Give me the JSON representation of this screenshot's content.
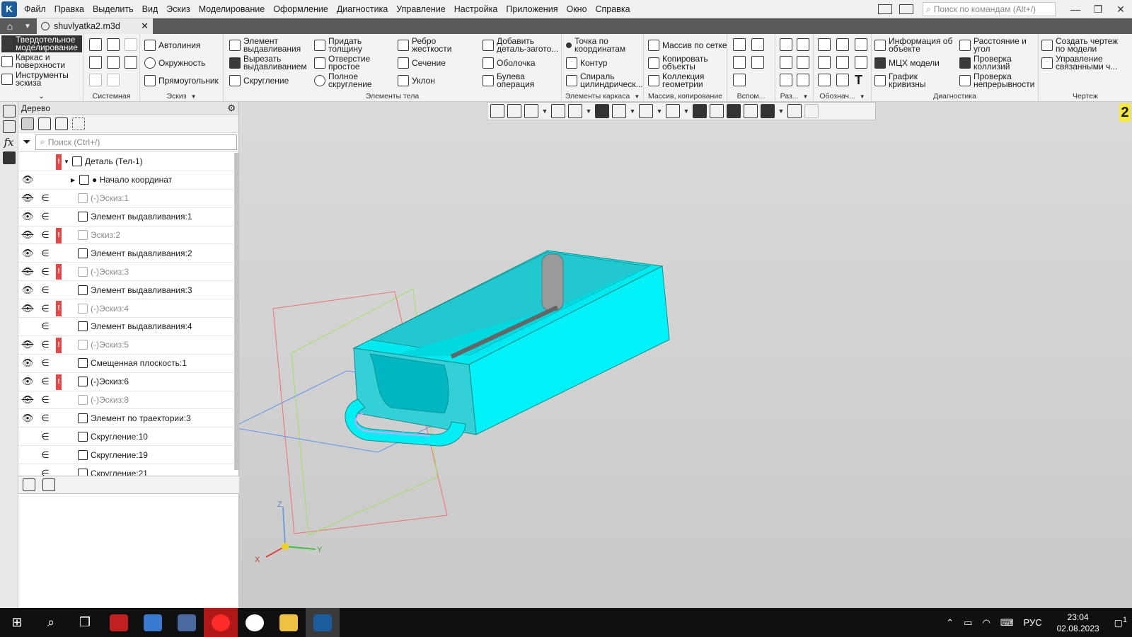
{
  "menubar": {
    "items": [
      "Файл",
      "Правка",
      "Выделить",
      "Вид",
      "Эскиз",
      "Моделирование",
      "Оформление",
      "Диагностика",
      "Управление",
      "Настройка",
      "Приложения",
      "Окно",
      "Справка"
    ],
    "search_placeholder": "Поиск по командам (Alt+/)"
  },
  "tab": {
    "title": "shuvlyatka2.m3d"
  },
  "ribbon": {
    "modes": [
      "Твердотельное моделирование",
      "Каркас и поверхности",
      "Инструменты эскиза"
    ],
    "groups": {
      "system": "Системная",
      "sketch": "Эскиз",
      "body": "Элементы тела",
      "frame": "Элементы каркаса",
      "array": "Массив, копирование",
      "aux": "Вспом...",
      "raz": "Раз...",
      "oboz": "Обознач...",
      "diag": "Диагностика",
      "drawing": "Чертеж"
    },
    "sketch_btns": [
      "Автолиния",
      "Окружность",
      "Прямоугольник"
    ],
    "body_btns": [
      "Элемент выдавливания",
      "Вырезать выдавливанием",
      "Скругление",
      "Придать толщину",
      "Отверстие простое",
      "Полное скругление",
      "Ребро жесткости",
      "Сечение",
      "Уклон",
      "Добавить деталь-загото...",
      "Оболочка",
      "Булева операция"
    ],
    "frame_btns": [
      "Точка по координатам",
      "Контур",
      "Спираль цилиндрическ..."
    ],
    "array_btns": [
      "Массив по сетке",
      "Копировать объекты",
      "Коллекция геометрии"
    ],
    "diag_btns": [
      "Информация об объекте",
      "МЦХ модели",
      "График кривизны",
      "Расстояние и угол",
      "Проверка коллизий",
      "Проверка непрерывности"
    ],
    "drawing_btns": [
      "Создать чертеж по модели",
      "Управление связанными ч..."
    ]
  },
  "tree": {
    "title": "Дерево",
    "search_placeholder": "Поиск (Ctrl+/)",
    "rows": [
      {
        "label": "Деталь (Тел-1)",
        "eye": "",
        "in": "",
        "err": true,
        "dim": false
      },
      {
        "label": "● Начало координат",
        "eye": "visible",
        "in": "",
        "err": false,
        "dim": false
      },
      {
        "label": "(-)Эскиз:1",
        "eye": "hidden",
        "in": "∈",
        "err": false,
        "dim": true
      },
      {
        "label": "Элемент выдавливания:1",
        "eye": "visible",
        "in": "∈",
        "err": false,
        "dim": false
      },
      {
        "label": "Эскиз:2",
        "eye": "hidden",
        "in": "∈",
        "err": true,
        "dim": true
      },
      {
        "label": "Элемент выдавливания:2",
        "eye": "visible",
        "in": "∈",
        "err": false,
        "dim": false
      },
      {
        "label": "(-)Эскиз:3",
        "eye": "hidden",
        "in": "∈",
        "err": true,
        "dim": true
      },
      {
        "label": "Элемент выдавливания:3",
        "eye": "visible",
        "in": "∈",
        "err": false,
        "dim": false
      },
      {
        "label": "(-)Эскиз:4",
        "eye": "hidden",
        "in": "∈",
        "err": true,
        "dim": true
      },
      {
        "label": "Элемент выдавливания:4",
        "eye": "",
        "in": "∈",
        "err": false,
        "dim": false
      },
      {
        "label": "(-)Эскиз:5",
        "eye": "hidden",
        "in": "∈",
        "err": true,
        "dim": true
      },
      {
        "label": "Смещенная плоскость:1",
        "eye": "visible",
        "in": "∈",
        "err": false,
        "dim": false
      },
      {
        "label": "(-)Эскиз:6",
        "eye": "visible",
        "in": "∈",
        "err": true,
        "dim": false
      },
      {
        "label": "(-)Эскиз:8",
        "eye": "hidden",
        "in": "∈",
        "err": false,
        "dim": true
      },
      {
        "label": "Элемент по траектории:3",
        "eye": "visible",
        "in": "∈",
        "err": false,
        "dim": false
      },
      {
        "label": "Скругление:10",
        "eye": "",
        "in": "∈",
        "err": false,
        "dim": false
      },
      {
        "label": "Скругление:19",
        "eye": "",
        "in": "∈",
        "err": false,
        "dim": false
      },
      {
        "label": "Скругление:21",
        "eye": "",
        "in": "∈",
        "err": false,
        "dim": false
      }
    ]
  },
  "viewport": {
    "badge": "2",
    "axes": {
      "x": "X",
      "y": "Y",
      "z": "Z"
    }
  },
  "colors": {
    "model": "#00ffff",
    "model_shade": "#00c8d0",
    "error": "#e74646"
  },
  "taskbar": {
    "lang": "РУС",
    "time": "23:04",
    "date": "02.08.2023",
    "notifications": "1"
  }
}
